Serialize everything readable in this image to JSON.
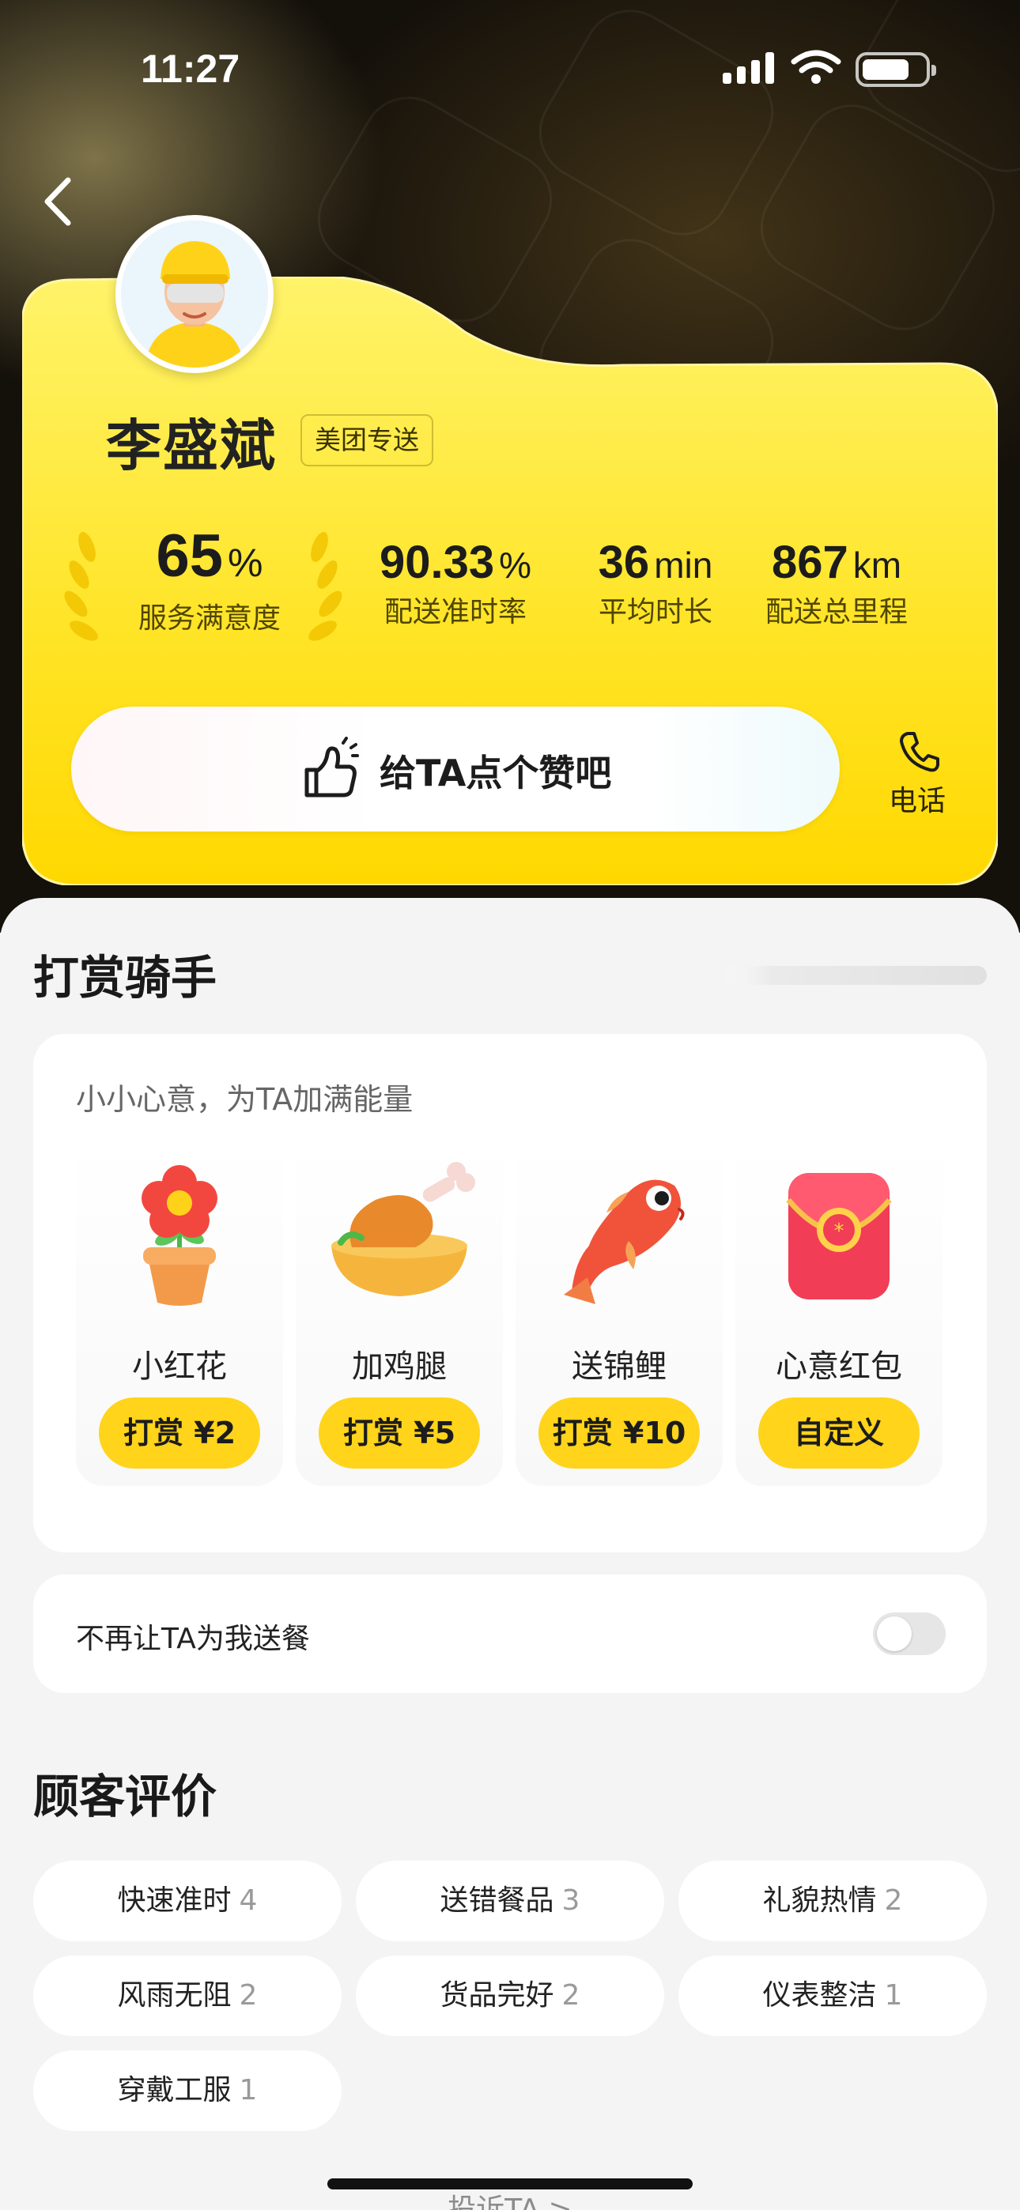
{
  "status_bar": {
    "time": "11:27",
    "icons": [
      "signal-icon",
      "wifi-icon",
      "battery-icon"
    ]
  },
  "nav": {
    "back_icon": "chevron-left-icon"
  },
  "rider": {
    "name": "李盛斌",
    "badge": "美团专送",
    "stats": [
      {
        "value": "65",
        "unit": "%",
        "label": "服务满意度"
      },
      {
        "value": "90.33",
        "unit": "%",
        "label": "配送准时率"
      },
      {
        "value": "36",
        "unit": "min",
        "label": "平均时长"
      },
      {
        "value": "867",
        "unit": "km",
        "label": "配送总里程"
      }
    ],
    "like_label": "给TA点个赞吧",
    "phone_label": "电话"
  },
  "tip": {
    "title": "打赏骑手",
    "subtitle": "小小心意，为TA加满能量",
    "gifts": [
      {
        "name": "小红花",
        "button": "打赏 ¥2",
        "icon": "flower-icon"
      },
      {
        "name": "加鸡腿",
        "button": "打赏 ¥5",
        "icon": "chicken-leg-icon"
      },
      {
        "name": "送锦鲤",
        "button": "打赏 ¥10",
        "icon": "koi-fish-icon"
      },
      {
        "name": "心意红包",
        "button": "自定义",
        "icon": "red-envelope-icon"
      }
    ]
  },
  "block": {
    "label": "不再让TA为我送餐",
    "enabled": false
  },
  "reviews": {
    "title": "顾客评价",
    "tags": [
      {
        "label": "快速准时",
        "count": "4"
      },
      {
        "label": "送错餐品",
        "count": "3"
      },
      {
        "label": "礼貌热情",
        "count": "2"
      },
      {
        "label": "风雨无阻",
        "count": "2"
      },
      {
        "label": "货品完好",
        "count": "2"
      },
      {
        "label": "仪表整洁",
        "count": "1"
      },
      {
        "label": "穿戴工服",
        "count": "1"
      }
    ]
  },
  "complaint_link": "投诉TA >",
  "colors": {
    "brand_yellow": "#ffd41a",
    "card_yellow": "#ffe62e",
    "page_bg": "#f4f4f4"
  }
}
